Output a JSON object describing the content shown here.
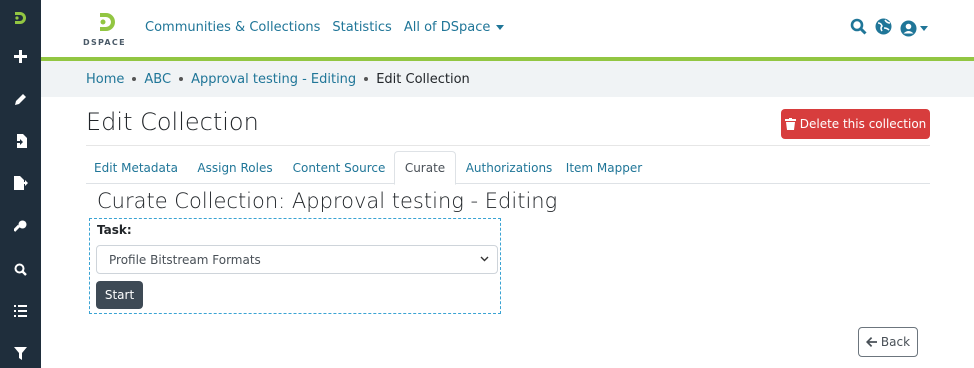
{
  "sidebar": {
    "items": [
      {
        "icon": "dspace-logo-icon"
      },
      {
        "icon": "plus-icon"
      },
      {
        "icon": "pencil-icon"
      },
      {
        "icon": "file-import-icon"
      },
      {
        "icon": "file-export-icon"
      },
      {
        "icon": "key-icon"
      },
      {
        "icon": "search-icon"
      },
      {
        "icon": "list-icon"
      },
      {
        "icon": "filter-icon"
      }
    ]
  },
  "header": {
    "logo_text": "DSPACE",
    "nav": [
      "Communities & Collections",
      "Statistics",
      "All of DSpace"
    ],
    "icons": [
      "search-icon",
      "globe-icon",
      "user-circle-icon"
    ],
    "colors": {
      "accent": "#207698",
      "bar": "#92c642"
    }
  },
  "breadcrumb": {
    "items": [
      "Home",
      "ABC",
      "Approval testing - Editing"
    ],
    "active": "Edit Collection"
  },
  "main": {
    "title": "Edit Collection",
    "delete_label": "Delete this collection",
    "tabs": [
      {
        "label": "Edit Metadata"
      },
      {
        "label": "Assign Roles"
      },
      {
        "label": "Content Source"
      },
      {
        "label": "Curate",
        "active": true
      },
      {
        "label": "Authorizations"
      },
      {
        "label": "Item Mapper"
      }
    ],
    "curate": {
      "heading": "Curate Collection: Approval testing - Editing",
      "task_label": "Task:",
      "task_value": "Profile Bitstream Formats",
      "start_label": "Start"
    },
    "back_label": "Back",
    "colors": {
      "danger": "#d73d3d",
      "dark": "#3e4a55"
    }
  }
}
